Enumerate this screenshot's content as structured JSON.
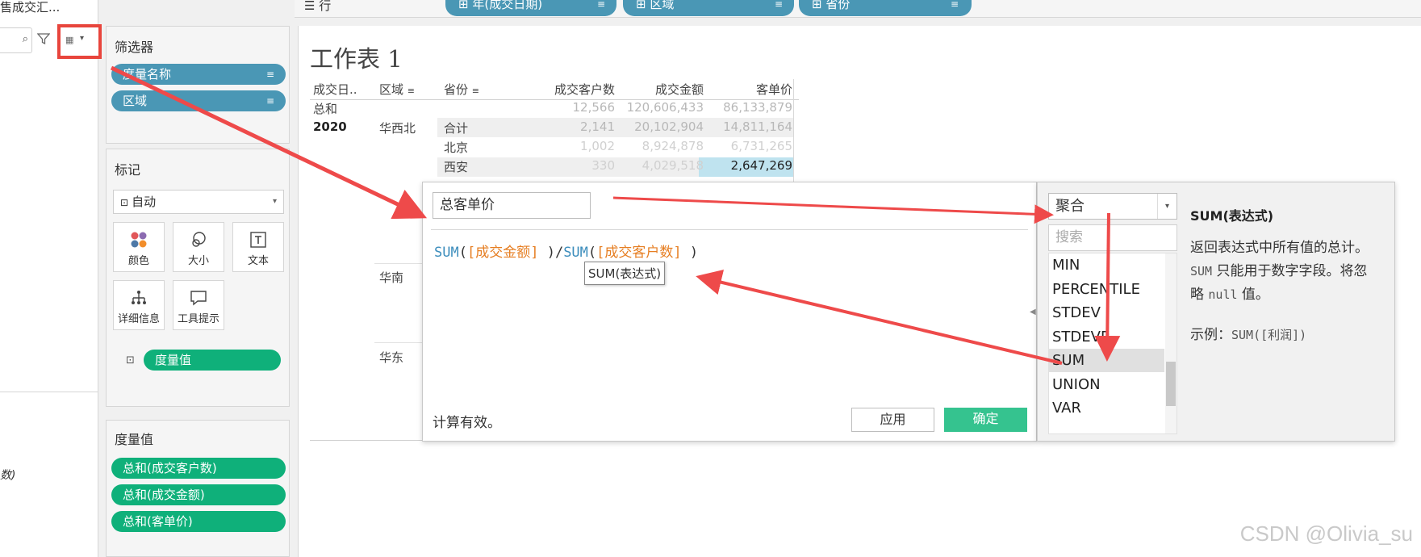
{
  "datasource": {
    "name": "售成交汇..."
  },
  "rows_shelf": {
    "label": "行",
    "pills": [
      {
        "label": "⊞ 年(成交日期)",
        "sort": "≡"
      },
      {
        "label": "⊞ 区域",
        "sort": "≡"
      },
      {
        "label": "⊞ 省份",
        "sort": "≡"
      }
    ]
  },
  "filters": {
    "title": "筛选器",
    "pills": [
      {
        "label": "度量名称",
        "sort": "≡"
      },
      {
        "label": "区域",
        "sort": "≡"
      }
    ]
  },
  "marks": {
    "title": "标记",
    "type": "自动",
    "buttons": [
      {
        "label": "颜色",
        "icon": "color-dots-icon"
      },
      {
        "label": "大小",
        "icon": "size-circles-icon"
      },
      {
        "label": "文本",
        "icon": "text-box-icon"
      },
      {
        "label": "详细信息",
        "icon": "detail-tree-icon"
      },
      {
        "label": "工具提示",
        "icon": "tooltip-bubble-icon"
      }
    ],
    "text_pill": "度量值"
  },
  "measure_values": {
    "title": "度量值",
    "pills": [
      "总和(成交客户数)",
      "总和(成交金额)",
      "总和(客单价)"
    ]
  },
  "left_fragment": "数)",
  "sheet": {
    "title": "工作表 1",
    "headers": [
      "成交日..",
      "区域",
      "省份",
      "成交客户数",
      "成交金额",
      "客单价"
    ],
    "grand_total": {
      "label": "总和",
      "values": [
        "12,566",
        "120,606,433",
        "86,133,879"
      ]
    },
    "year": "2020",
    "regions": [
      "华西北",
      "华南",
      "华东"
    ],
    "rows": [
      {
        "province": "合计",
        "values": [
          "2,141",
          "20,102,904",
          "14,811,164"
        ]
      },
      {
        "province": "北京",
        "values": [
          "1,002",
          "8,924,878",
          "6,731,265"
        ]
      },
      {
        "province": "西安",
        "values": [
          "330",
          "4,029,518",
          "2,647,269"
        ]
      }
    ]
  },
  "calc_dialog": {
    "name": "总客单价",
    "formula": {
      "fn1": "SUM",
      "field1": "[成交金额]",
      "op": "/",
      "fn2": "SUM",
      "field2": "[成交客户数]"
    },
    "tooltip": "SUM(表达式)",
    "status": "计算有效。",
    "apply_label": "应用",
    "ok_label": "确定"
  },
  "function_panel": {
    "category": "聚合",
    "search_placeholder": "搜索",
    "items": [
      "MIN",
      "PERCENTILE",
      "STDEV",
      "STDEVP",
      "SUM",
      "UNION",
      "VAR"
    ],
    "selected": "SUM",
    "title": "SUM(表达式)",
    "desc_1": "返回表达式中所有值的总计。",
    "desc_code": "SUM",
    "desc_2": " 只能用于数字字段。将忽略 ",
    "desc_null": "null",
    "desc_3": " 值。",
    "example_label": "示例：",
    "example_code": "SUM([利润])"
  },
  "watermark": "CSDN @Olivia_su",
  "colors": {
    "pill_blue": "#4a97b5",
    "pill_green": "#0fb07a",
    "ok_button": "#35c38f",
    "annotation_red": "#ee4a4a",
    "highlight_cell": "#bfe3ef"
  }
}
